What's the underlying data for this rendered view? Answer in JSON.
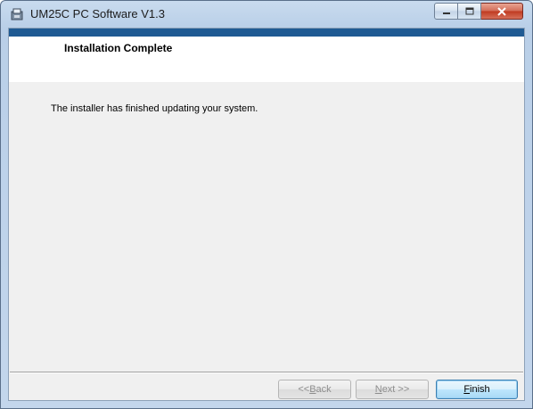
{
  "window": {
    "title": "UM25C PC Software V1.3",
    "icon": "installer-disk-icon"
  },
  "caption_buttons": {
    "minimize_icon": "minimize-icon",
    "maximize_icon": "maximize-icon",
    "close_icon": "close-icon"
  },
  "banner": {
    "heading": "Installation Complete",
    "stripe_color": "#1f5a93"
  },
  "body": {
    "message": "The installer has finished updating your system."
  },
  "buttons": {
    "back": {
      "prefix": "<< ",
      "mnemonic": "B",
      "rest": "ack",
      "enabled": false
    },
    "next": {
      "mnemonic": "N",
      "rest": "ext >>",
      "enabled": false
    },
    "finish": {
      "mnemonic": "F",
      "rest": "inish",
      "enabled": true
    }
  }
}
